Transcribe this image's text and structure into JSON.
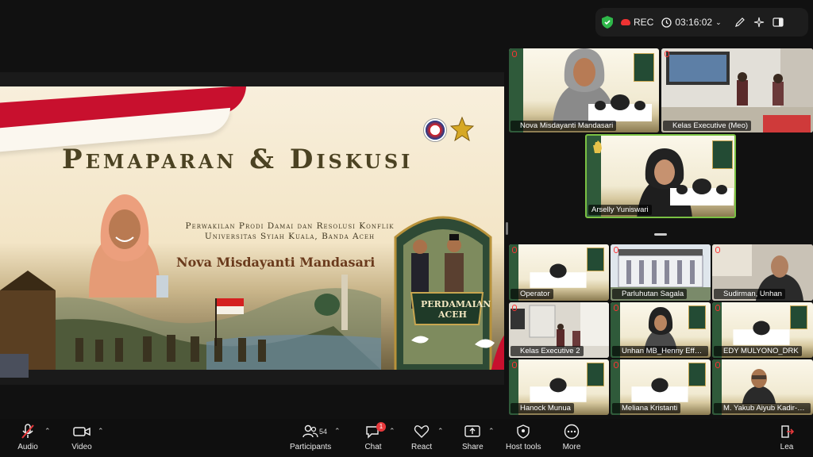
{
  "topbar": {
    "rec_label": "REC",
    "timer": "03:16:02"
  },
  "slide": {
    "title": "Pemaparan & Diskusi",
    "subtitle_line1": "Perwakilan Prodi Damai dan Resolusi Konflik",
    "subtitle_line2": "Universitas Syiah Kuala, Banda Aceh",
    "presenter_name": "Nova Misdayanti Mandasari",
    "emblem_text_line1": "PERDAMAIAN",
    "emblem_text_line2": "ACEH"
  },
  "participants_top": [
    {
      "name": "Nova Misdayanti Mandasari"
    },
    {
      "name": "Kelas Executive (Meo)"
    },
    {
      "name": "Arselly Yuniswari"
    }
  ],
  "participants_grid": [
    {
      "name": "Operator"
    },
    {
      "name": "Parluhutan Sagala"
    },
    {
      "name": "Sudirman, Unhan"
    },
    {
      "name": "Kelas Executive 2"
    },
    {
      "name": "Unhan MB_Henny Effendi"
    },
    {
      "name": "EDY MULYONO_DRK"
    },
    {
      "name": "Hanock Munua"
    },
    {
      "name": "Meliana Kristanti"
    },
    {
      "name": "M. Yakub Aiyub Kadir-M..."
    }
  ],
  "toolbar": {
    "audio": "Audio",
    "video": "Video",
    "participants": "Participants",
    "participant_count": "54",
    "chat": "Chat",
    "chat_badge": "1",
    "react": "React",
    "share": "Share",
    "host_tools": "Host tools",
    "more": "More",
    "leave": "Lea"
  },
  "colors": {
    "active_speaker_border": "#7ac143",
    "leave_red": "#e8393c",
    "slide_title": "#4b4222"
  }
}
